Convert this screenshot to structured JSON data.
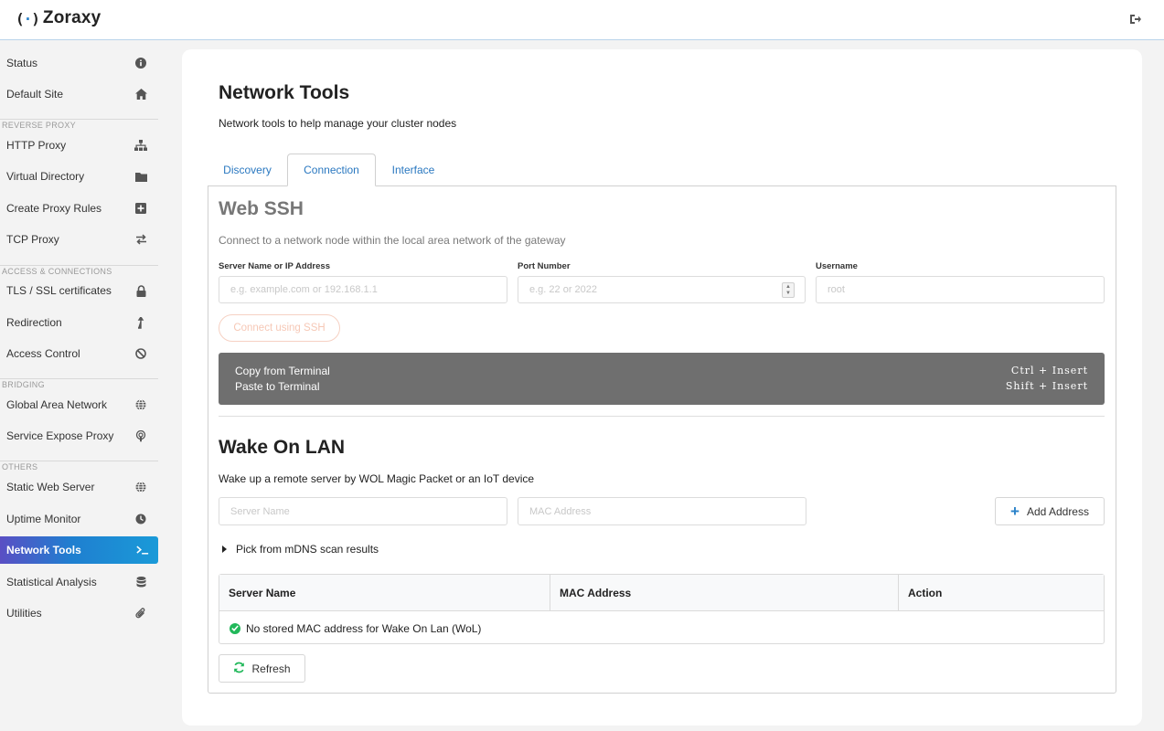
{
  "app": {
    "logo_mark_left": "(",
    "logo_mark_dot": "·",
    "logo_mark_right": ")",
    "name": "Zoraxy",
    "logout_icon": "sign-out-icon"
  },
  "sidebar": {
    "items": [
      {
        "label": "Status",
        "icon": "info-circle-icon"
      },
      {
        "label": "Default Site",
        "icon": "home-icon"
      },
      {
        "label": "HTTP Proxy",
        "icon": "sitemap-icon"
      },
      {
        "label": "Virtual Directory",
        "icon": "folder-icon"
      },
      {
        "label": "Create Proxy Rules",
        "icon": "plus-square-icon"
      },
      {
        "label": "TCP Proxy",
        "icon": "exchange-icon"
      },
      {
        "label": "TLS / SSL certificates",
        "icon": "lock-icon"
      },
      {
        "label": "Redirection",
        "icon": "level-up-icon"
      },
      {
        "label": "Access Control",
        "icon": "ban-icon"
      },
      {
        "label": "Global Area Network",
        "icon": "globe-icon"
      },
      {
        "label": "Service Expose Proxy",
        "icon": "podcast-icon"
      },
      {
        "label": "Static Web Server",
        "icon": "globe-icon"
      },
      {
        "label": "Uptime Monitor",
        "icon": "clock-icon"
      },
      {
        "label": "Network Tools",
        "icon": "terminal-icon"
      },
      {
        "label": "Statistical Analysis",
        "icon": "database-icon"
      },
      {
        "label": "Utilities",
        "icon": "paperclip-icon"
      }
    ],
    "sections": {
      "reverse_proxy": "REVERSE PROXY",
      "access": "ACCESS & CONNECTIONS",
      "bridging": "BRIDGING",
      "others": "OTHERS"
    },
    "active": "Network Tools",
    "active_gradient": [
      "#5a4fc4",
      "#1a9ad8"
    ]
  },
  "main": {
    "title": "Network Tools",
    "subtitle": "Network tools to help manage your cluster nodes",
    "tabs": [
      {
        "label": "Discovery"
      },
      {
        "label": "Connection"
      },
      {
        "label": "Interface"
      }
    ],
    "active_tab": "Connection"
  },
  "webssh": {
    "title": "Web SSH",
    "desc": "Connect to a network node within the local area network of the gateway",
    "server_label": "Server Name or IP Address",
    "server_placeholder": "e.g. example.com or 192.168.1.1",
    "port_label": "Port Number",
    "port_placeholder": "e.g. 22 or 2022",
    "user_label": "Username",
    "user_placeholder": "root",
    "connect_label": "Connect using SSH",
    "terminal": {
      "copy_label": "Copy from Terminal",
      "copy_shortcut": "Ctrl + Insert",
      "paste_label": "Paste to Terminal",
      "paste_shortcut": "Shift + Insert"
    }
  },
  "wol": {
    "title": "Wake On LAN",
    "desc": "Wake up a remote server by WOL Magic Packet or an IoT device",
    "server_name_placeholder": "Server Name",
    "mac_placeholder": "MAC Address",
    "add_label": "Add Address",
    "mdns_label": "Pick from mDNS scan results",
    "table": {
      "headers": [
        "Server Name",
        "MAC Address",
        "Action"
      ],
      "empty_message": "No stored MAC address for Wake On Lan (WoL)"
    },
    "refresh_label": "Refresh"
  },
  "colors": {
    "accent": "#2a82c9",
    "success": "#21b85a",
    "terminal_bg": "#6f6f6f"
  }
}
